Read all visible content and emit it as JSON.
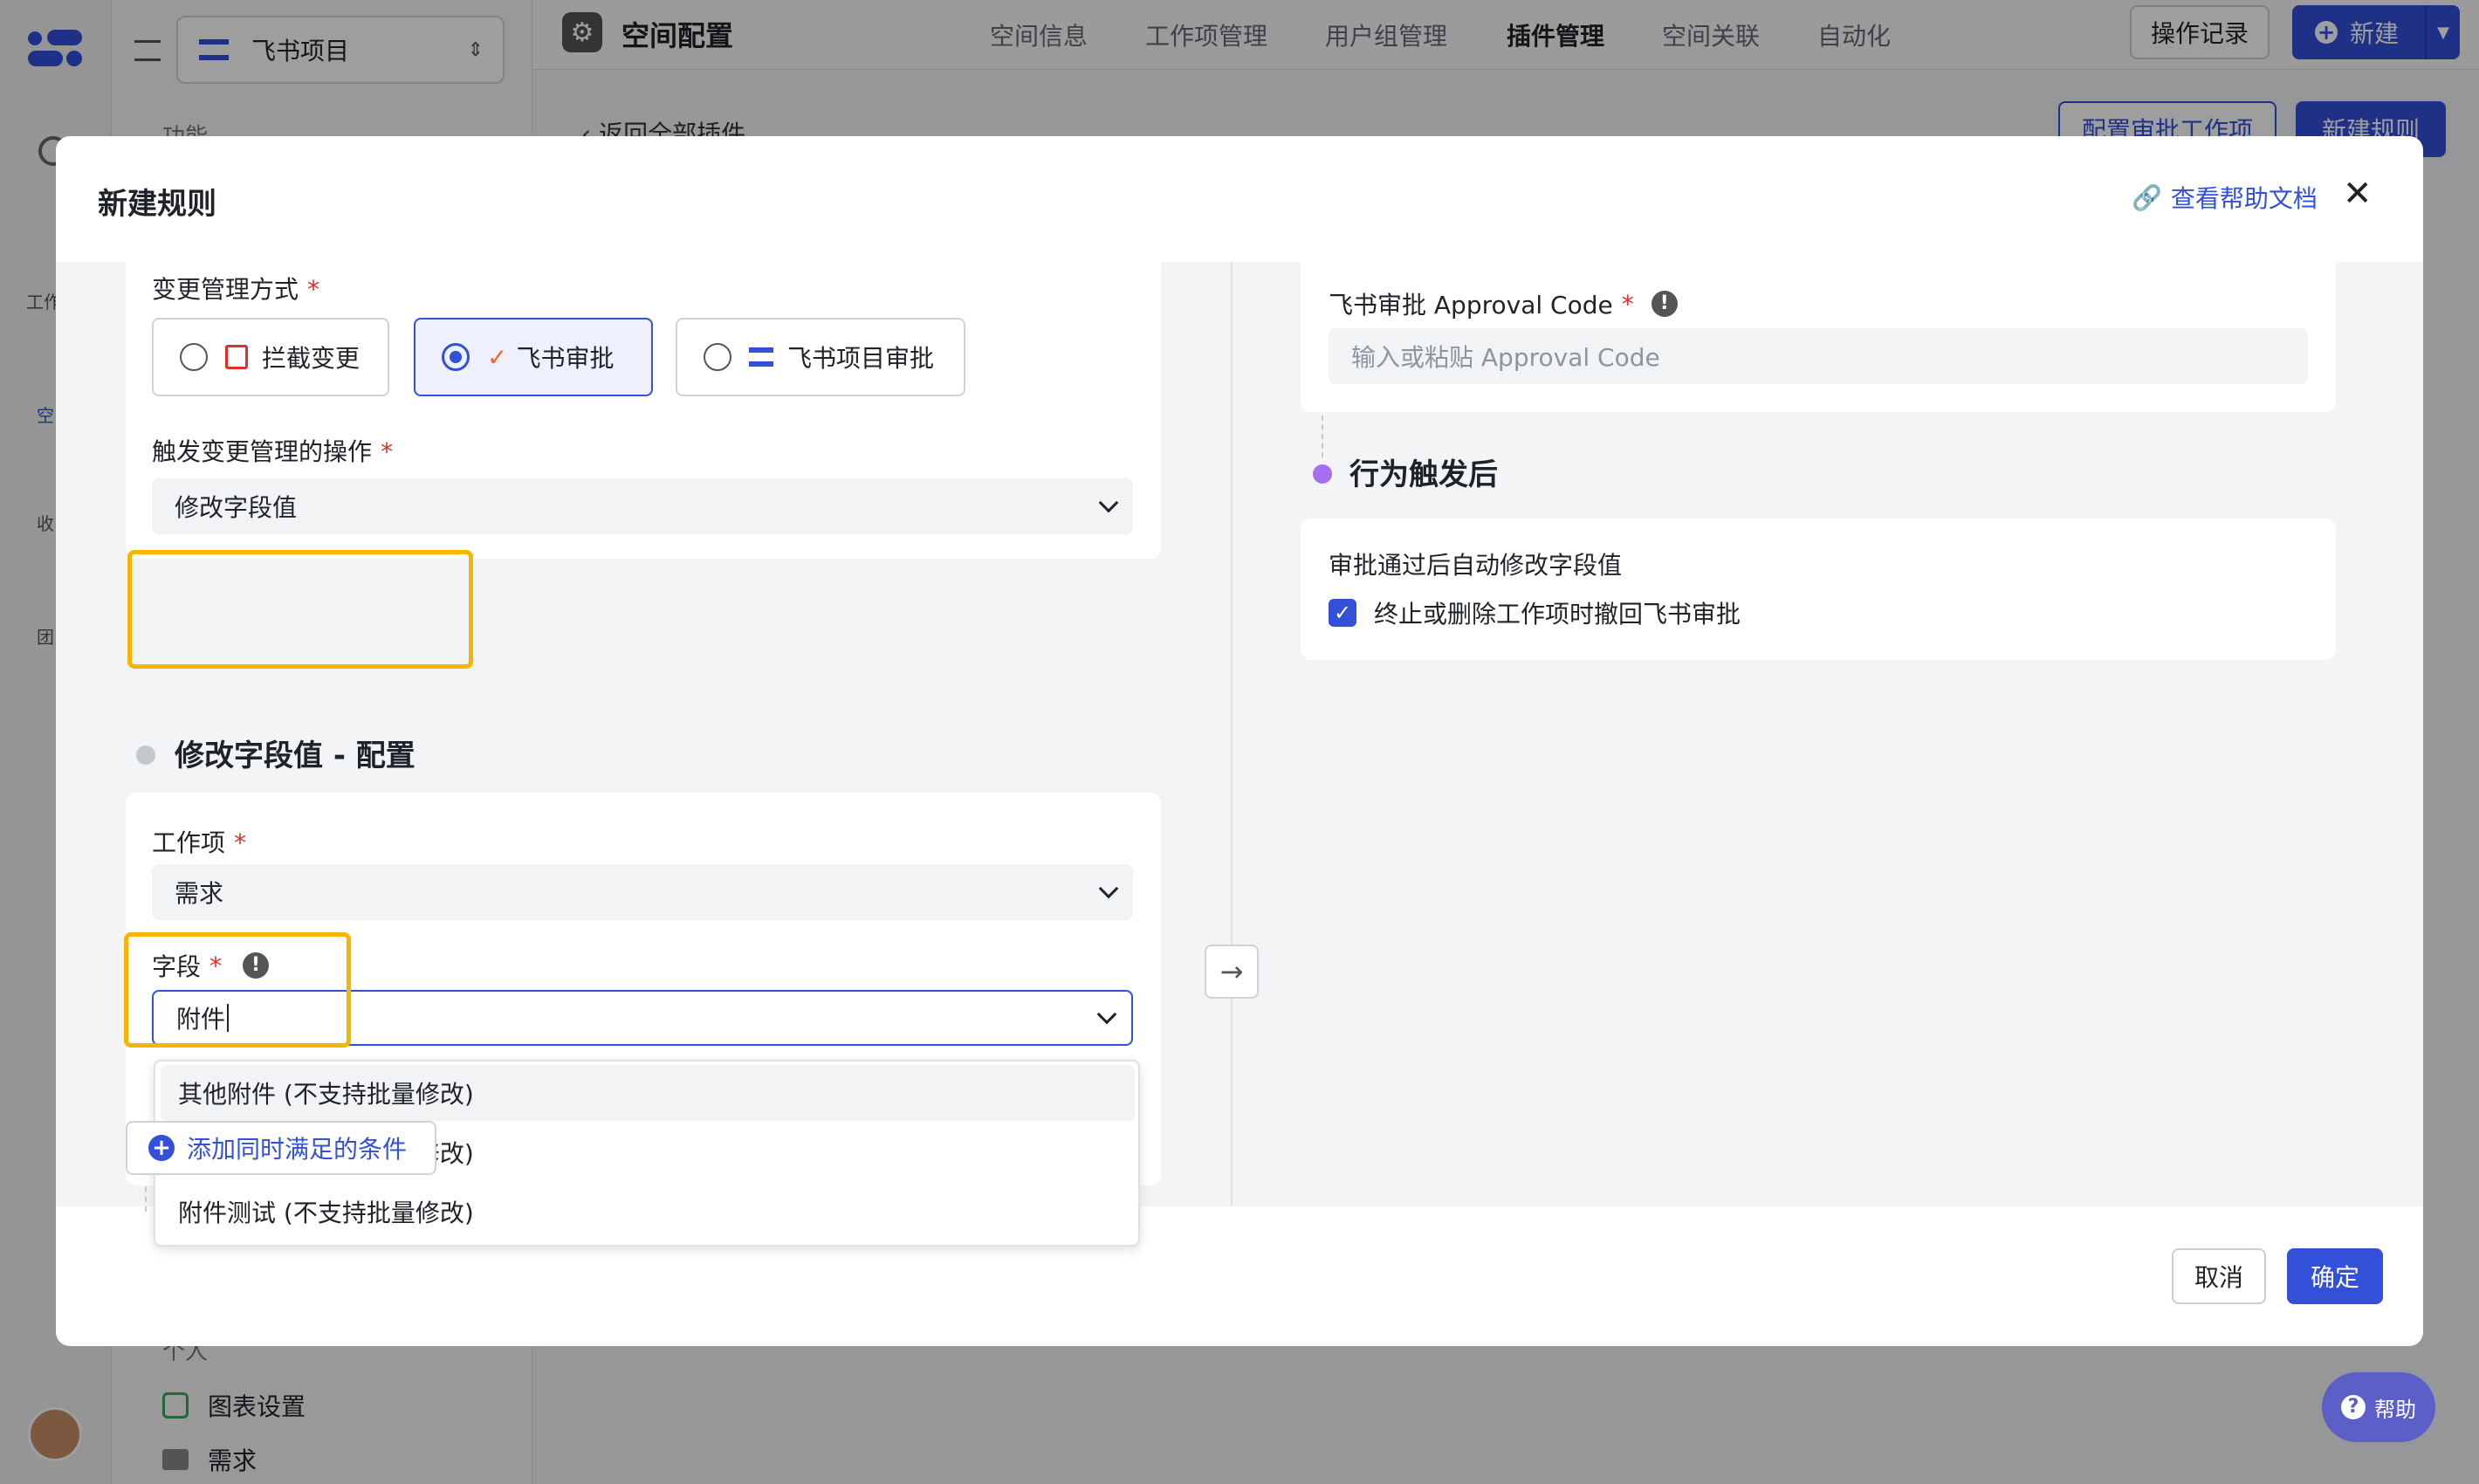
{
  "colors": {
    "accent": "#3250d8",
    "highlight": "#f7b500",
    "required": "#e22e28",
    "dot": "#a66ef0"
  },
  "sidebar": {
    "project": "飞书项目",
    "section": "功能",
    "rail_items": [
      "工作",
      "空",
      "收",
      "团"
    ],
    "bottom_items": [
      {
        "icon": "list-icon",
        "label": "图表设置"
      },
      {
        "icon": "folder-icon",
        "label": "需求"
      }
    ],
    "personal": "个人"
  },
  "topbar": {
    "title": "空间配置",
    "tabs": [
      "空间信息",
      "工作项管理",
      "用户组管理",
      "插件管理",
      "空间关联",
      "自动化"
    ],
    "active_tab": "插件管理",
    "log_button": "操作记录",
    "new_button": "新建"
  },
  "page": {
    "back_link": "返回全部插件",
    "config_button": "配置审批工作项",
    "new_rule_button": "新建规则"
  },
  "modal": {
    "title": "新建规则",
    "help_link": "查看帮助文档",
    "left": {
      "change_mode_label": "变更管理方式",
      "options": [
        {
          "label": "拦截变更",
          "selected": false
        },
        {
          "label": "飞书审批",
          "selected": true
        },
        {
          "label": "飞书项目审批",
          "selected": false
        }
      ],
      "trigger_label": "触发变更管理的操作",
      "trigger_value": "修改字段值",
      "section_title": "修改字段值 - 配置",
      "workitem_label": "工作项",
      "workitem_value": "需求",
      "field_label": "字段",
      "field_value": "附件",
      "dropdown": [
        "其他附件 (不支持批量修改)",
        "文档附件 (不支持批量修改)",
        "附件测试 (不支持批量修改)"
      ],
      "add_condition": "添加同时满足的条件"
    },
    "right": {
      "approval_code_label": "飞书审批 Approval Code",
      "approval_code_placeholder": "输入或粘贴 Approval Code",
      "section_title": "行为触发后",
      "auto_label": "审批通过后自动修改字段值",
      "checkbox_label": "终止或删除工作项时撤回飞书审批",
      "checkbox_checked": true
    },
    "cancel": "取消",
    "confirm": "确定"
  },
  "help_button": "帮助"
}
